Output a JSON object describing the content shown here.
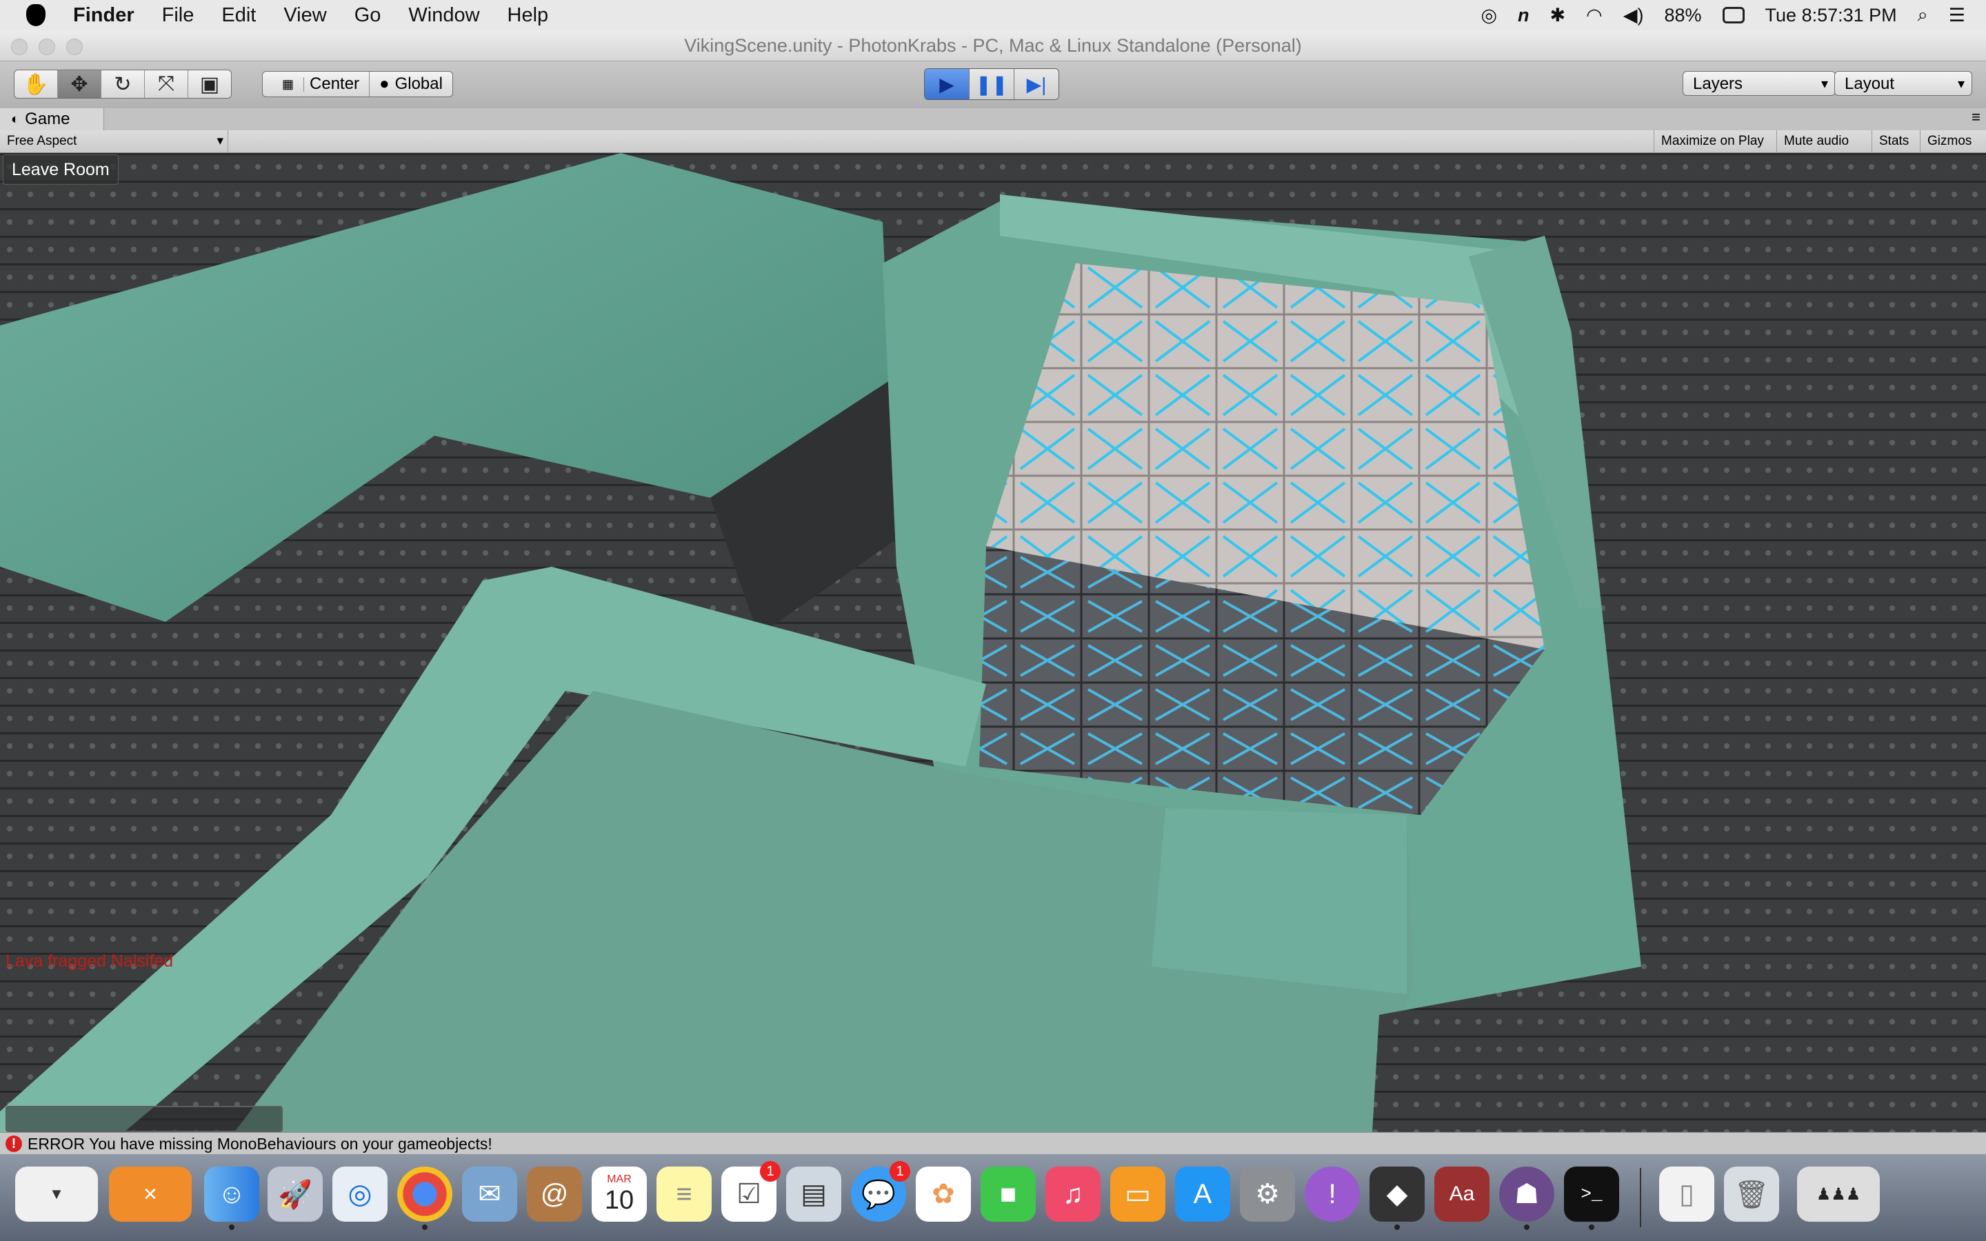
{
  "menubar": {
    "app": "Finder",
    "menus": [
      "File",
      "Edit",
      "View",
      "Go",
      "Window",
      "Help"
    ],
    "battery": "88%",
    "clock": "Tue 8:57:31 PM"
  },
  "window": {
    "title": "VikingScene.unity - PhotonKrabs - PC, Mac & Linux Standalone (Personal)"
  },
  "toolbar": {
    "pivot_label": "Center",
    "space_label": "Global",
    "layers_label": "Layers",
    "layout_label": "Layout"
  },
  "game_tab": {
    "title": "Game",
    "aspect": "Free Aspect",
    "maximize_on_play": "Maximize on Play",
    "mute_audio": "Mute audio",
    "stats": "Stats",
    "gizmos": "Gizmos"
  },
  "viewport": {
    "leave_room_label": "Leave Room",
    "kill_message": "Lava fragged Nalsifed",
    "chat_placeholder": ""
  },
  "console": {
    "message": "ERROR You have missing MonoBehaviours on your gameobjects!"
  },
  "dock": {
    "calendar_month": "MAR",
    "calendar_day": "10",
    "reminders_badge": "1",
    "messages_badge": "1",
    "dictionary_label": "Aa",
    "terminal_label": ">_"
  },
  "colors": {
    "floor_teal": "#5a9e8c",
    "wall_dark": "#3b3d3f",
    "crate_light": "#c9c4c2",
    "crate_accent": "#35c6ee",
    "error_red": "#d82020",
    "play_blue": "#3b74d3"
  }
}
